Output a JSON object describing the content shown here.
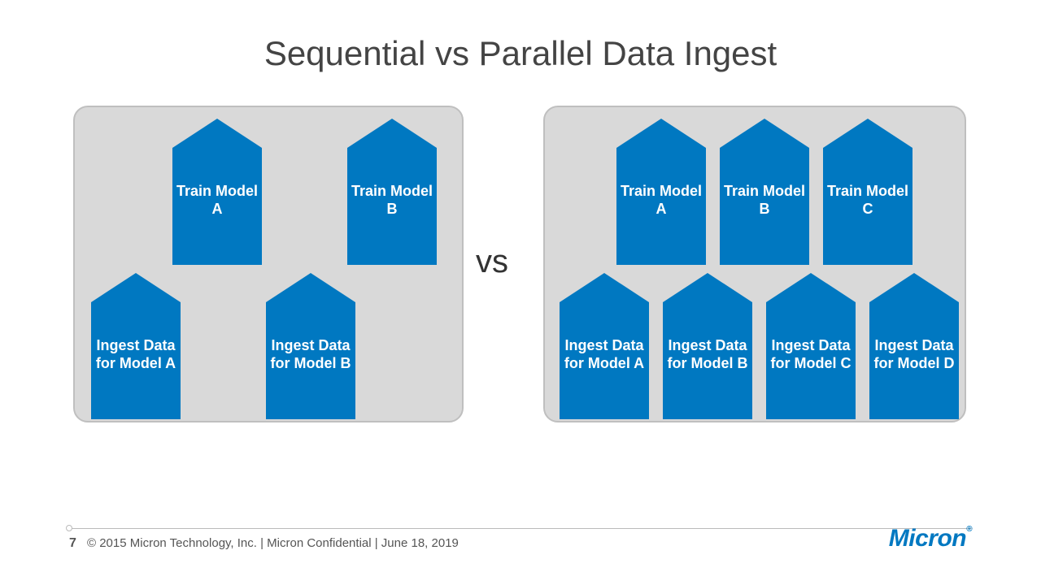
{
  "title": "Sequential vs Parallel Data Ingest",
  "vs_label": "vs",
  "left_panel": {
    "top_row": [
      {
        "text": "Train Model A"
      },
      {
        "text": "Train Model B"
      }
    ],
    "bottom_row": [
      {
        "text": "Ingest Data for Model A"
      },
      {
        "text": "Ingest Data for Model B"
      }
    ]
  },
  "right_panel": {
    "top_row": [
      {
        "text": "Train Model A"
      },
      {
        "text": "Train Model B"
      },
      {
        "text": "Train Model C"
      }
    ],
    "bottom_row": [
      {
        "text": "Ingest Data for Model A"
      },
      {
        "text": "Ingest Data for Model B"
      },
      {
        "text": "Ingest Data for Model C"
      },
      {
        "text": "Ingest Data for Model D"
      }
    ]
  },
  "footer": {
    "page_number": "7",
    "copyright": "© 2015 Micron Technology, Inc.  |  Micron Confidential  |  June 18, 2019",
    "logo_text": "Micron"
  },
  "colors": {
    "accent": "#0078c1",
    "panel_bg": "#d9d9d9",
    "panel_border": "#bfbfbf"
  }
}
